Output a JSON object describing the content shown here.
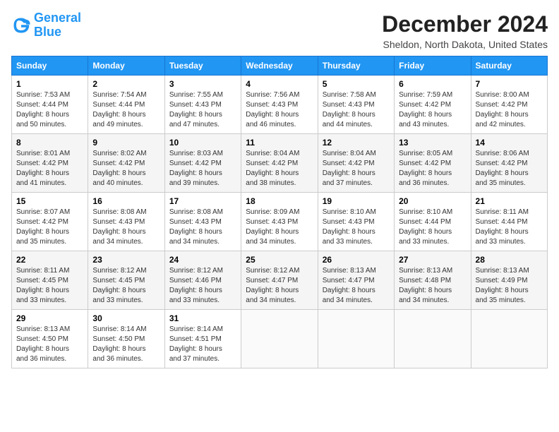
{
  "logo": {
    "text1": "General",
    "text2": "Blue"
  },
  "title": "December 2024",
  "location": "Sheldon, North Dakota, United States",
  "days_header": [
    "Sunday",
    "Monday",
    "Tuesday",
    "Wednesday",
    "Thursday",
    "Friday",
    "Saturday"
  ],
  "weeks": [
    [
      {
        "day": "1",
        "info": "Sunrise: 7:53 AM\nSunset: 4:44 PM\nDaylight: 8 hours\nand 50 minutes."
      },
      {
        "day": "2",
        "info": "Sunrise: 7:54 AM\nSunset: 4:44 PM\nDaylight: 8 hours\nand 49 minutes."
      },
      {
        "day": "3",
        "info": "Sunrise: 7:55 AM\nSunset: 4:43 PM\nDaylight: 8 hours\nand 47 minutes."
      },
      {
        "day": "4",
        "info": "Sunrise: 7:56 AM\nSunset: 4:43 PM\nDaylight: 8 hours\nand 46 minutes."
      },
      {
        "day": "5",
        "info": "Sunrise: 7:58 AM\nSunset: 4:43 PM\nDaylight: 8 hours\nand 44 minutes."
      },
      {
        "day": "6",
        "info": "Sunrise: 7:59 AM\nSunset: 4:42 PM\nDaylight: 8 hours\nand 43 minutes."
      },
      {
        "day": "7",
        "info": "Sunrise: 8:00 AM\nSunset: 4:42 PM\nDaylight: 8 hours\nand 42 minutes."
      }
    ],
    [
      {
        "day": "8",
        "info": "Sunrise: 8:01 AM\nSunset: 4:42 PM\nDaylight: 8 hours\nand 41 minutes."
      },
      {
        "day": "9",
        "info": "Sunrise: 8:02 AM\nSunset: 4:42 PM\nDaylight: 8 hours\nand 40 minutes."
      },
      {
        "day": "10",
        "info": "Sunrise: 8:03 AM\nSunset: 4:42 PM\nDaylight: 8 hours\nand 39 minutes."
      },
      {
        "day": "11",
        "info": "Sunrise: 8:04 AM\nSunset: 4:42 PM\nDaylight: 8 hours\nand 38 minutes."
      },
      {
        "day": "12",
        "info": "Sunrise: 8:04 AM\nSunset: 4:42 PM\nDaylight: 8 hours\nand 37 minutes."
      },
      {
        "day": "13",
        "info": "Sunrise: 8:05 AM\nSunset: 4:42 PM\nDaylight: 8 hours\nand 36 minutes."
      },
      {
        "day": "14",
        "info": "Sunrise: 8:06 AM\nSunset: 4:42 PM\nDaylight: 8 hours\nand 35 minutes."
      }
    ],
    [
      {
        "day": "15",
        "info": "Sunrise: 8:07 AM\nSunset: 4:42 PM\nDaylight: 8 hours\nand 35 minutes."
      },
      {
        "day": "16",
        "info": "Sunrise: 8:08 AM\nSunset: 4:43 PM\nDaylight: 8 hours\nand 34 minutes."
      },
      {
        "day": "17",
        "info": "Sunrise: 8:08 AM\nSunset: 4:43 PM\nDaylight: 8 hours\nand 34 minutes."
      },
      {
        "day": "18",
        "info": "Sunrise: 8:09 AM\nSunset: 4:43 PM\nDaylight: 8 hours\nand 34 minutes."
      },
      {
        "day": "19",
        "info": "Sunrise: 8:10 AM\nSunset: 4:43 PM\nDaylight: 8 hours\nand 33 minutes."
      },
      {
        "day": "20",
        "info": "Sunrise: 8:10 AM\nSunset: 4:44 PM\nDaylight: 8 hours\nand 33 minutes."
      },
      {
        "day": "21",
        "info": "Sunrise: 8:11 AM\nSunset: 4:44 PM\nDaylight: 8 hours\nand 33 minutes."
      }
    ],
    [
      {
        "day": "22",
        "info": "Sunrise: 8:11 AM\nSunset: 4:45 PM\nDaylight: 8 hours\nand 33 minutes."
      },
      {
        "day": "23",
        "info": "Sunrise: 8:12 AM\nSunset: 4:45 PM\nDaylight: 8 hours\nand 33 minutes."
      },
      {
        "day": "24",
        "info": "Sunrise: 8:12 AM\nSunset: 4:46 PM\nDaylight: 8 hours\nand 33 minutes."
      },
      {
        "day": "25",
        "info": "Sunrise: 8:12 AM\nSunset: 4:47 PM\nDaylight: 8 hours\nand 34 minutes."
      },
      {
        "day": "26",
        "info": "Sunrise: 8:13 AM\nSunset: 4:47 PM\nDaylight: 8 hours\nand 34 minutes."
      },
      {
        "day": "27",
        "info": "Sunrise: 8:13 AM\nSunset: 4:48 PM\nDaylight: 8 hours\nand 34 minutes."
      },
      {
        "day": "28",
        "info": "Sunrise: 8:13 AM\nSunset: 4:49 PM\nDaylight: 8 hours\nand 35 minutes."
      }
    ],
    [
      {
        "day": "29",
        "info": "Sunrise: 8:13 AM\nSunset: 4:50 PM\nDaylight: 8 hours\nand 36 minutes."
      },
      {
        "day": "30",
        "info": "Sunrise: 8:14 AM\nSunset: 4:50 PM\nDaylight: 8 hours\nand 36 minutes."
      },
      {
        "day": "31",
        "info": "Sunrise: 8:14 AM\nSunset: 4:51 PM\nDaylight: 8 hours\nand 37 minutes."
      },
      {
        "day": "",
        "info": ""
      },
      {
        "day": "",
        "info": ""
      },
      {
        "day": "",
        "info": ""
      },
      {
        "day": "",
        "info": ""
      }
    ]
  ]
}
